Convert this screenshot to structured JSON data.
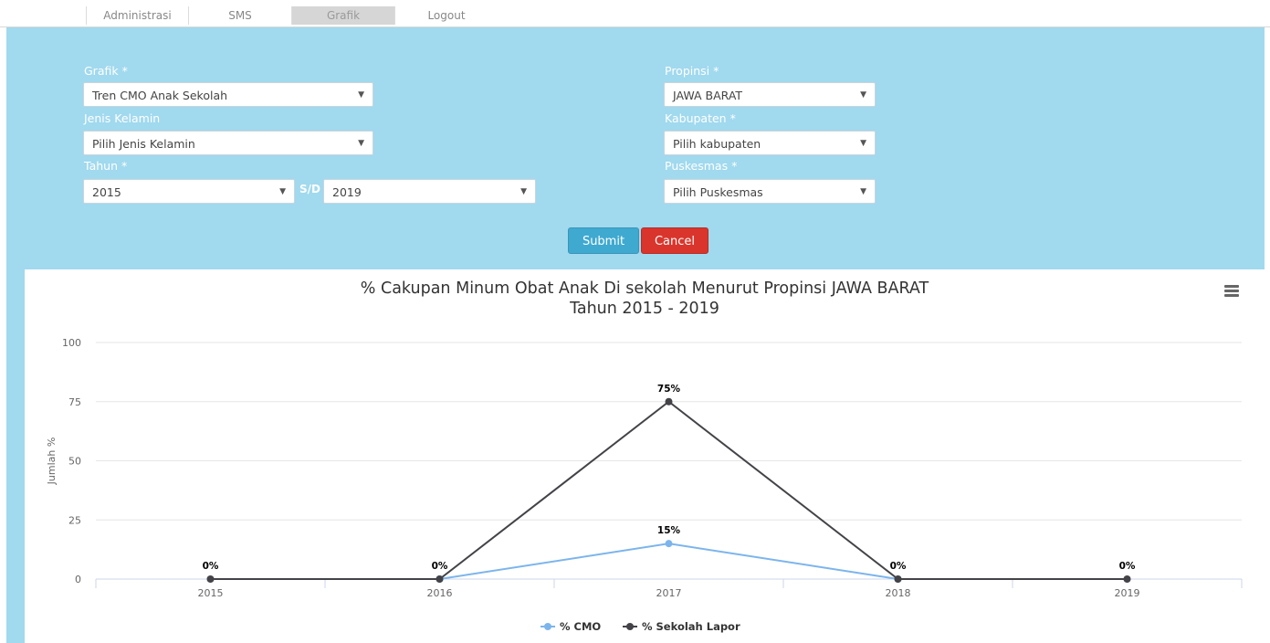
{
  "nav": {
    "tabs": [
      {
        "label": "Administrasi"
      },
      {
        "label": "SMS"
      },
      {
        "label": "Grafik",
        "active": true
      },
      {
        "label": "Logout"
      }
    ]
  },
  "form": {
    "grafik": {
      "label": "Grafik *",
      "value": "Tren CMO Anak Sekolah"
    },
    "jenis_kelamin": {
      "label": "Jenis Kelamin",
      "value": "Pilih Jenis Kelamin"
    },
    "tahun": {
      "label": "Tahun *",
      "from": "2015",
      "sd_label": "S/D",
      "to": "2019"
    },
    "propinsi": {
      "label": "Propinsi *",
      "value": "JAWA BARAT"
    },
    "kabupaten": {
      "label": "Kabupaten *",
      "value": "Pilih kabupaten"
    },
    "puskesmas": {
      "label": "Puskesmas *",
      "value": "Pilih Puskesmas"
    },
    "submit_label": "Submit",
    "cancel_label": "Cancel",
    "caret": "▼"
  },
  "colors": {
    "panel": "#a1d9ee",
    "submit": "#3fa9d0",
    "cancel": "#d9352c",
    "series_cmo": "#7cb5ec",
    "series_lapor": "#434348"
  },
  "chart_data": {
    "type": "line",
    "title": "% Cakupan Minum Obat Anak Di sekolah Menurut Propinsi JAWA BARAT",
    "subtitle": "Tahun 2015 - 2019",
    "ylabel": "Jumlah %",
    "xlabel": "",
    "categories": [
      "2015",
      "2016",
      "2017",
      "2018",
      "2019"
    ],
    "ylim": [
      0,
      100
    ],
    "yticks": [
      0,
      25,
      50,
      75,
      100
    ],
    "grid": true,
    "legend_position": "bottom-center",
    "series": [
      {
        "name": "% CMO",
        "color": "#7cb5ec",
        "values": [
          null,
          0,
          15,
          0,
          null
        ],
        "labels": [
          "",
          "",
          "15%",
          "",
          ""
        ]
      },
      {
        "name": "% Sekolah Lapor",
        "color": "#434348",
        "values": [
          0,
          0,
          75,
          0,
          0
        ],
        "labels": [
          "0%",
          "0%",
          "75%",
          "0%",
          "0%"
        ]
      }
    ]
  }
}
